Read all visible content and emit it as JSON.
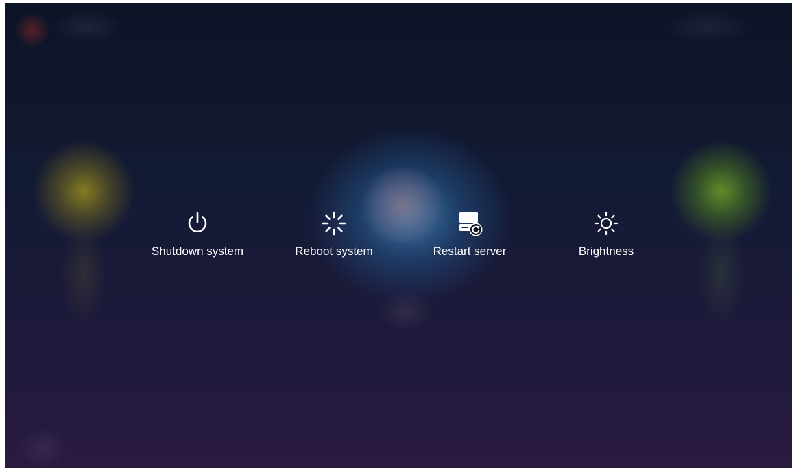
{
  "menu": {
    "items": [
      {
        "label": "Shutdown system",
        "icon": "power-icon"
      },
      {
        "label": "Reboot system",
        "icon": "loading-spinner-icon"
      },
      {
        "label": "Restart server",
        "icon": "server-restart-icon"
      },
      {
        "label": "Brightness",
        "icon": "sun-icon"
      }
    ]
  },
  "colors": {
    "label": "#ffffff",
    "icon": "#ffffff",
    "background_top": "#0d1426",
    "background_bottom": "#2a1a40"
  }
}
